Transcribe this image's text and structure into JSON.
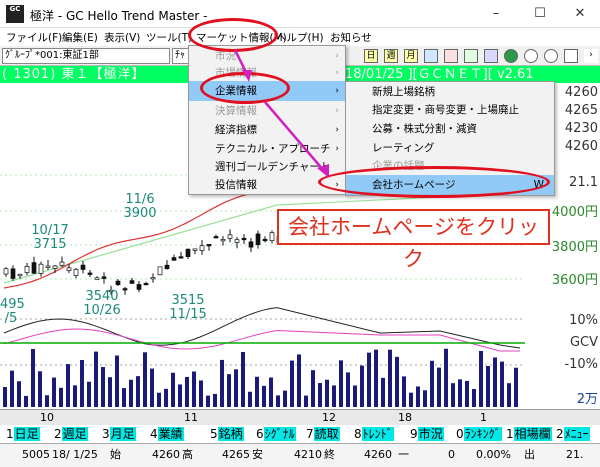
{
  "window": {
    "app_icon_text": "GC",
    "title": "極洋 - GC Hello Trend Master -",
    "minimize": "–",
    "maximize": "☐",
    "close": "✕"
  },
  "menubar": {
    "items": [
      "ファイル(F)",
      "編集(E)",
      "表示(V)",
      "ツール(T)",
      "マーケット情報(M)",
      "ヘルプ(H)",
      "お知らせ"
    ]
  },
  "toolbar": {
    "group_combo": "ｸﾞﾙｰﾌﾟ*001:東証1部",
    "chart_combo": "ﾁｬｰ",
    "icons": [
      "日",
      "週",
      "月"
    ]
  },
  "infobar": {
    "stock_text": "( 1301) 東１【極洋】",
    "date_text": "18/01/25 ][ＧＣＮＥＴ][ v2.61"
  },
  "chart": {
    "price_scale": [
      "4260",
      "4265",
      "4230",
      "4260",
      "21.1"
    ],
    "level_labels": [
      "4000円",
      "3800円",
      "3600円"
    ],
    "indicator_labels": [
      "10%",
      "GCV",
      "-10%"
    ],
    "volume_label": "2万",
    "annotations": [
      {
        "line1": "11/6",
        "line2": "3900"
      },
      {
        "line1": "10/17",
        "line2": "3715"
      },
      {
        "line1": "3540",
        "line2": "10/26"
      },
      {
        "line1": "3515",
        "line2": "11/15"
      },
      {
        "line1": "495",
        "line2": "/5"
      }
    ],
    "chart_data": {
      "type": "bar",
      "x_labels": [
        "10",
        "11",
        "12",
        "18",
        "1"
      ]
    }
  },
  "function_keys": [
    {
      "num": "1",
      "label": "日足"
    },
    {
      "num": "2",
      "label": "週足"
    },
    {
      "num": "3",
      "label": "月足"
    },
    {
      "num": "4",
      "label": "業績"
    },
    {
      "num": "5",
      "label": "銘柄"
    },
    {
      "num": "6",
      "label": "ｼｸﾞﾅﾙ"
    },
    {
      "num": "7",
      "label": "読取"
    },
    {
      "num": "8",
      "label": "ﾄﾚﾝﾄﾞ"
    },
    {
      "num": "9",
      "label": "市況"
    },
    {
      "num": "0",
      "label": "ﾗﾝｷﾝｸﾞ"
    },
    {
      "num": "1",
      "label": "相場欄"
    },
    {
      "num": "2",
      "label": "ﾒﾆｭｰ"
    }
  ],
  "statusbar": {
    "code": "5005",
    "date": "18/ 1/25",
    "open_label": "始",
    "open": "4260",
    "high_label": "高",
    "high": "4265",
    "low_label": "安",
    "low": "4210",
    "close_label": "終",
    "close": "4260",
    "change": "一",
    "change_val": "0",
    "pct": "0.00%",
    "vol_label": "出",
    "vol": "21."
  },
  "market_menu": {
    "items": [
      {
        "label": "市況",
        "arrow": "›"
      },
      {
        "label": "市場情報",
        "arrow": "›"
      },
      {
        "label": "企業情報",
        "arrow": "›"
      },
      {
        "label": "決算情報",
        "arrow": "›"
      },
      {
        "label": "経済指標",
        "arrow": "›"
      },
      {
        "label": "テクニカル・アプローチ",
        "arrow": "›"
      },
      {
        "label": "週刊ゴールデンチャート",
        "arrow": ""
      },
      {
        "label": "投信情報",
        "arrow": "›"
      }
    ]
  },
  "company_submenu": {
    "items": [
      {
        "label": "新規上場銘柄",
        "shortcut": ""
      },
      {
        "label": "指定変更・商号変更・上場廃止",
        "shortcut": ""
      },
      {
        "label": "公募・株式分割・減資",
        "shortcut": ""
      },
      {
        "label": "レーティング",
        "shortcut": ""
      },
      {
        "label": "企業の話題",
        "shortcut": ""
      },
      {
        "label": "会社ホームページ",
        "shortcut": "W"
      }
    ]
  },
  "callout": {
    "text": "会社ホームページをクリック"
  },
  "colors": {
    "accent_green": "#00ff60",
    "callout_red": "#e0301e",
    "selection_blue": "#91c9f7",
    "volume_navy": "#1a1a7a"
  }
}
